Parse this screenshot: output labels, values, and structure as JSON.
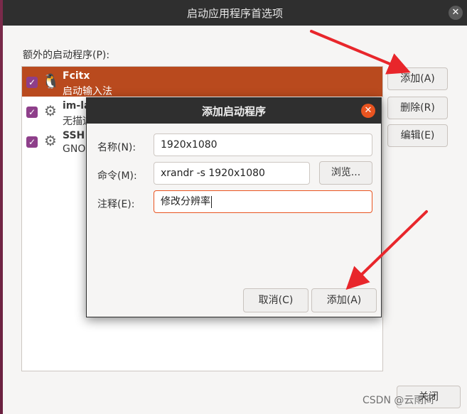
{
  "window": {
    "title": "启动应用程序首选项",
    "close_glyph": "✕"
  },
  "startup": {
    "section_label": "额外的启动程序(P):",
    "items": [
      {
        "name": "Fcitx",
        "desc": "启动输入法",
        "checked": true,
        "icon": "penguin-icon"
      },
      {
        "name": "im-la",
        "desc": "无描述",
        "checked": true,
        "icon": "gears-icon"
      },
      {
        "name": "SSH",
        "desc": "GNO",
        "checked": true,
        "icon": "gears-icon"
      }
    ],
    "check_glyph": "✓",
    "add_label": "添加(A)",
    "remove_label": "删除(R)",
    "edit_label": "编辑(E)",
    "close_label": "关闭"
  },
  "dialog": {
    "title": "添加启动程序",
    "close_glyph": "✕",
    "name_label": "名称(N):",
    "name_value": "1920x1080",
    "command_label": "命令(M):",
    "command_value": "xrandr -s 1920x1080",
    "browse_label": "浏览...",
    "comment_label": "注释(E):",
    "comment_value": "修改分辨率",
    "cancel_label": "取消(C)",
    "add_label": "添加(A)"
  },
  "watermark": "CSDN @云雨间",
  "colors": {
    "accent": "#e95420",
    "selection": "#b94a1e",
    "checkbox": "#8e3f8a",
    "annotation_arrow": "#e8262b"
  }
}
